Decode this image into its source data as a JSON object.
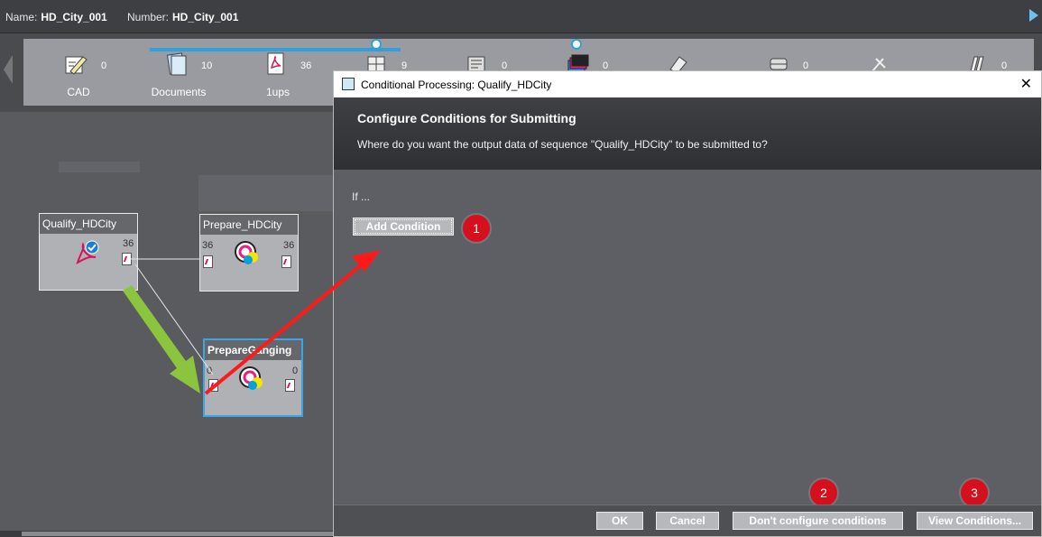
{
  "infobar": {
    "name_label": "Name:",
    "name_value": "HD_City_001",
    "number_label": "Number:",
    "number_value": "HD_City_001"
  },
  "steps": [
    {
      "label": "CAD",
      "count": "0",
      "icon": "cad-pencil-icon"
    },
    {
      "label": "Documents",
      "count": "10",
      "icon": "documents-icon"
    },
    {
      "label": "1ups",
      "count": "36",
      "icon": "pdf-document-icon"
    },
    {
      "label": "",
      "count": "9",
      "icon": "imposition-icon"
    },
    {
      "label": "",
      "count": "0",
      "icon": "sheet-icon"
    },
    {
      "label": "",
      "count": "0",
      "icon": "color-stack-icon"
    },
    {
      "label": "",
      "count": "",
      "icon": "plate-icon"
    },
    {
      "label": "",
      "count": "0",
      "icon": "press-icon"
    },
    {
      "label": "",
      "count": "",
      "icon": "cutting-icon"
    },
    {
      "label": "",
      "count": "0",
      "icon": "finishing-icon"
    }
  ],
  "workflow": {
    "nodes": [
      {
        "title": "Qualify_HDCity",
        "out_count": "36",
        "icon": "pdf-check-icon"
      },
      {
        "title": "Prepare_HDCity",
        "in_count": "36",
        "out_count": "36",
        "icon": "color-disc-icon"
      },
      {
        "title": "PrepareGanging",
        "in_count": "0",
        "out_count": "0",
        "icon": "color-disc-icon"
      }
    ]
  },
  "dialog": {
    "title": "Conditional Processing: Qualify_HDCity",
    "heading": "Configure Conditions for Submitting",
    "subtitle": "Where do you want the output data of sequence \"Qualify_HDCity\" to be submitted to?",
    "if_text": "If ...",
    "add_condition": "Add Condition",
    "buttons": {
      "ok": "OK",
      "cancel": "Cancel",
      "dont_configure": "Don't configure conditions",
      "view_conditions": "View Conditions..."
    },
    "badges": [
      "1",
      "2",
      "3"
    ]
  },
  "colors": {
    "accent_blue": "#2ea0e0",
    "badge_red": "#d5101c",
    "arrow_red": "#ff1a1a",
    "arrow_green": "#8bc43f"
  }
}
